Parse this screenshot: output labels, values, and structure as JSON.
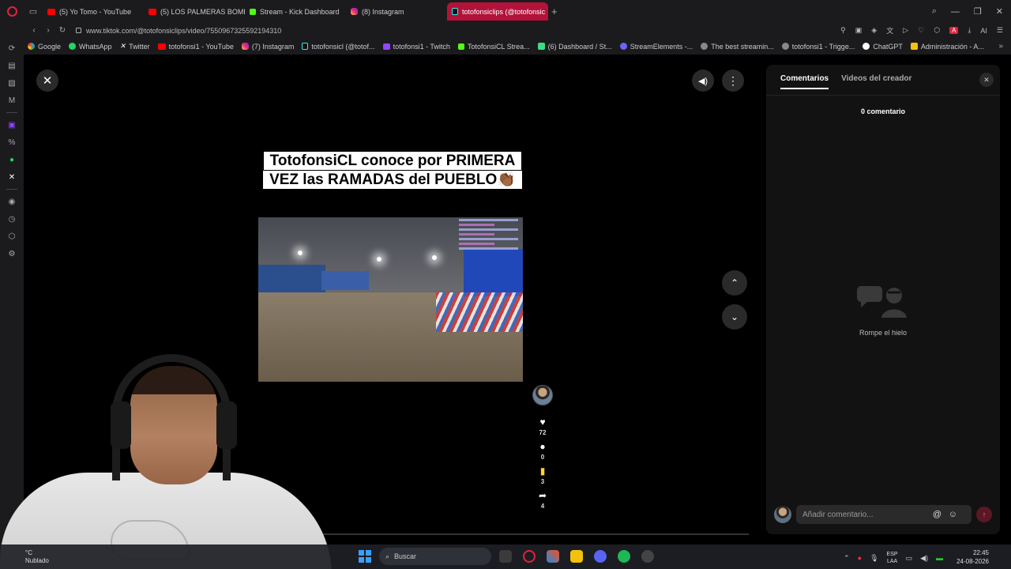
{
  "browser": {
    "tabs": [
      {
        "label": "(5) Yo Tomo - YouTube",
        "icon": "youtube-icon",
        "active": false
      },
      {
        "label": "(5) LOS PALMERAS BOMB",
        "icon": "youtube-icon",
        "active": false
      },
      {
        "label": "Stream - Kick Dashboard",
        "icon": "kick-icon",
        "active": false
      },
      {
        "label": "(8) Instagram",
        "icon": "instagram-icon",
        "active": false
      },
      {
        "label": "totofonsiclips (@totofonsic",
        "icon": "tiktok-icon",
        "active": true
      }
    ],
    "new_tab": "+",
    "url": "www.tiktok.com/@totofonsiclips/video/7550967325592194310",
    "ai_label": "AI",
    "bookmarks": [
      {
        "label": "Google",
        "icon": "google-icon"
      },
      {
        "label": "WhatsApp",
        "icon": "whatsapp-icon"
      },
      {
        "label": "Twitter",
        "icon": "x-icon"
      },
      {
        "label": "totofonsi1 - YouTube",
        "icon": "youtube-icon"
      },
      {
        "label": "(7) Instagram",
        "icon": "instagram-icon"
      },
      {
        "label": "totofonsicl (@totof...",
        "icon": "tiktok-icon"
      },
      {
        "label": "totofonsi1 - Twitch",
        "icon": "twitch-icon"
      },
      {
        "label": "TotofonsiCL Strea...",
        "icon": "kick-icon"
      },
      {
        "label": "(6) Dashboard / St...",
        "icon": "dashboard-icon"
      },
      {
        "label": "StreamElements -...",
        "icon": "streamelements-icon"
      },
      {
        "label": "The best streamin...",
        "icon": "generic-icon"
      },
      {
        "label": "totofonsi1 - Trigge...",
        "icon": "generic-icon"
      },
      {
        "label": "ChatGPT",
        "icon": "chatgpt-icon"
      },
      {
        "label": "Administración - A...",
        "icon": "admin-icon"
      }
    ]
  },
  "video": {
    "caption": "TotofonsiCL conoce por PRIMERA VEZ las RAMADAS del PUEBLO👏🏾",
    "progress": 0.08,
    "actions": {
      "likes": "72",
      "comments": "0",
      "saves": "3",
      "shares": "4"
    }
  },
  "panel": {
    "tab_comments": "Comentarios",
    "tab_creator_videos": "Videos del creador",
    "comment_count": "0 comentario",
    "empty_text": "Rompe el hielo",
    "input_placeholder": "Añadir comentario...",
    "at_symbol": "@",
    "emoji_symbol": "☺",
    "send_symbol": "↑"
  },
  "taskbar": {
    "weather_temp": "°C",
    "weather_text": "Nublado",
    "search_placeholder": "Buscar",
    "lang_top": "ESP",
    "lang_bottom": "LAA",
    "time": "22:45",
    "date": "24-08-2026"
  },
  "colors": {
    "accent": "#fe2c55",
    "active_tab": "#b3123a",
    "panel_bg": "#121212"
  }
}
